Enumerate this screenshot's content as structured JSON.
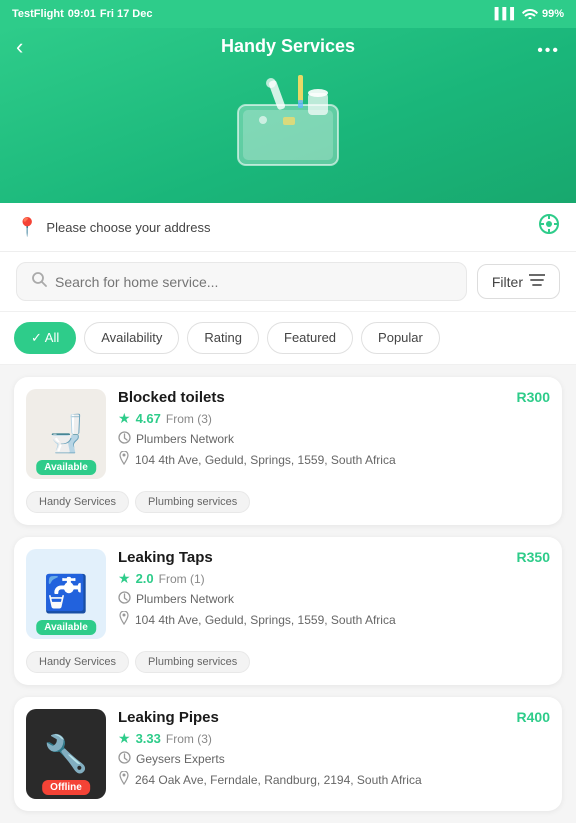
{
  "status_bar": {
    "left_label": "TestFlight",
    "time": "09:01",
    "date": "Fri 17 Dec",
    "signal": "▌▌▌",
    "wifi": "WiFi",
    "battery": "99%"
  },
  "header": {
    "back_icon": "‹",
    "title": "Handy Services",
    "dots": "•••"
  },
  "location": {
    "placeholder": "Please choose your address",
    "pin_icon": "📍",
    "target_icon": "⊕"
  },
  "search": {
    "placeholder": "Search for home service...",
    "search_icon": "🔍",
    "filter_label": "Filter",
    "filter_icon": "≡"
  },
  "chips": [
    {
      "label": "All",
      "active": true
    },
    {
      "label": "Availability",
      "active": false
    },
    {
      "label": "Rating",
      "active": false
    },
    {
      "label": "Featured",
      "active": false
    },
    {
      "label": "Popular",
      "active": false
    }
  ],
  "services": [
    {
      "id": 1,
      "title": "Blocked toilets",
      "rating": "4.67",
      "rating_count": "From (3)",
      "price": "R300",
      "provider": "Plumbers Network",
      "address": "104 4th Ave, Geduld, Springs, 1559, South Africa",
      "availability": "Available",
      "availability_type": "available",
      "tags": [
        "Handy Services",
        "Plumbing services"
      ],
      "emoji": "🚽",
      "bg": "toilet"
    },
    {
      "id": 2,
      "title": "Leaking Taps",
      "rating": "2.0",
      "rating_count": "From (1)",
      "price": "R350",
      "provider": "Plumbers Network",
      "address": "104 4th Ave, Geduld, Springs, 1559, South Africa",
      "availability": "Available",
      "availability_type": "available",
      "tags": [
        "Handy Services",
        "Plumbing services"
      ],
      "emoji": "🚰",
      "bg": "tap"
    },
    {
      "id": 3,
      "title": "Leaking Pipes",
      "rating": "3.33",
      "rating_count": "From (3)",
      "price": "R400",
      "provider": "Geysers Experts",
      "address": "264 Oak Ave, Ferndale, Randburg, 2194, South Africa",
      "availability": "Offline",
      "availability_type": "offline",
      "tags": [],
      "emoji": "🔧",
      "bg": "pipe"
    }
  ],
  "icons": {
    "star": "★",
    "provider": "⏰",
    "location_pin": "📍"
  }
}
